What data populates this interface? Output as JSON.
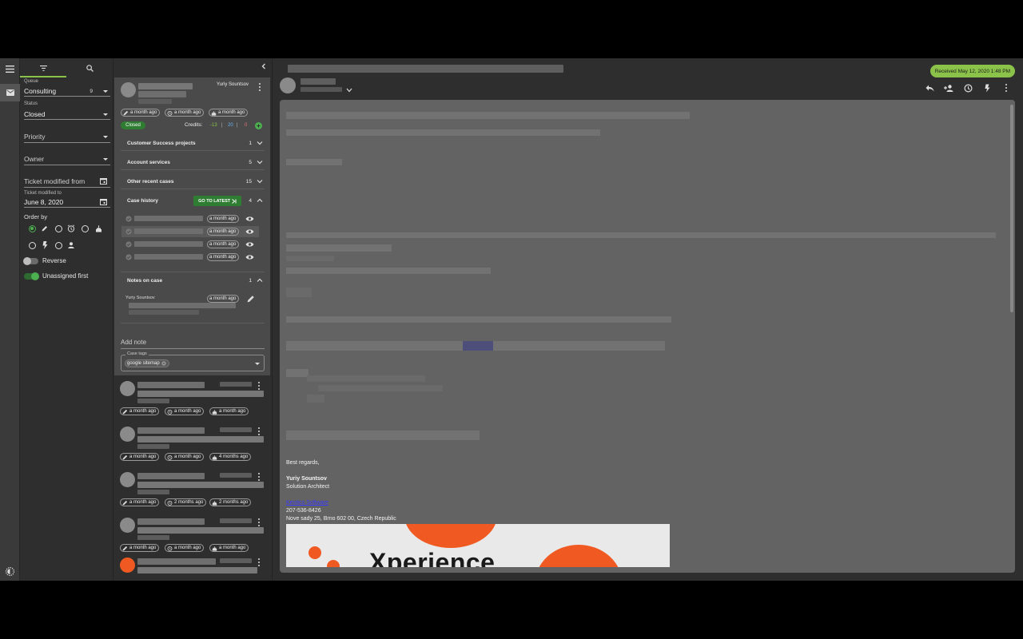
{
  "filters": {
    "queue_label": "Queue",
    "queue_value": "Consulting",
    "queue_count": "9",
    "status_label": "Status",
    "status_value": "Closed",
    "priority_placeholder": "Priority",
    "owner_placeholder": "Owner",
    "modified_from_placeholder": "Ticket modified from",
    "modified_to_label": "Ticket modified to",
    "modified_to_value": "June 8, 2020",
    "order_by_label": "Order by",
    "order_by_selected": "created",
    "reverse_label": "Reverse",
    "reverse_on": false,
    "unassigned_first_label": "Unassigned first",
    "unassigned_first_on": true
  },
  "case_card": {
    "owner_name": "Yuriy Sountsov",
    "chips": [
      "a month ago",
      "a month ago",
      "a month ago"
    ],
    "status_badge": "Closed",
    "credits_label": "Credits:",
    "credits_values": [
      "-13",
      "20",
      "0"
    ],
    "sections": [
      {
        "title": "Customer Success projects",
        "count": "1"
      },
      {
        "title": "Account services",
        "count": "5"
      },
      {
        "title": "Other recent cases",
        "count": "15"
      }
    ],
    "history": {
      "title": "Case history",
      "go_latest_label": "GO TO LATEST",
      "count": "4",
      "rows": [
        "a month ago",
        "a month ago",
        "a month ago",
        "a month ago"
      ]
    },
    "notes": {
      "title": "Notes on case",
      "count": "1",
      "author": "Yuriy Sountsov",
      "time": "a month ago"
    },
    "add_note_placeholder": "Add note",
    "case_tags_label": "Case tags",
    "tags": [
      "google sitemap"
    ]
  },
  "case_list": [
    {
      "chips": [
        "a month ago",
        "a month ago",
        "a month ago"
      ]
    },
    {
      "chips": [
        "a month ago",
        "a month ago",
        "4 months ago"
      ]
    },
    {
      "chips": [
        "a month ago",
        "2 months ago",
        "2 months ago"
      ]
    },
    {
      "chips": [
        "a month ago",
        "a month ago",
        "a month ago"
      ]
    }
  ],
  "mail": {
    "received_badge": "Received May 12, 2020 1:48 PM",
    "signature": {
      "greeting": "Best regards,",
      "name": "Yuriy Sountsov",
      "title": "Solution Architect",
      "link": "Kentico Software",
      "phone": "207-536-8426",
      "address": "Nove sady 25, Brno 602 00, Czech Republic"
    },
    "banner_text": "Xperience"
  },
  "colors": {
    "accent_green": "#8bc34a",
    "status_green": "#2e7d32",
    "brand_orange": "#f05a22",
    "credit_negative": "#8bc34a",
    "credit_positive": "#64b5f6",
    "credit_zero": "#e57373"
  },
  "icons": {
    "rail": [
      "menu-icon",
      "mail-icon",
      "brightness-icon"
    ],
    "filter_tabs": [
      "filter-icon",
      "search-icon"
    ],
    "order_by": [
      "radio",
      "pencil-icon",
      "radio",
      "alarm-icon",
      "radio",
      "cake-icon",
      "radio",
      "flash-icon",
      "radio",
      "person-icon"
    ],
    "toolbar": [
      "reply-icon",
      "person-add-icon",
      "history-icon",
      "flash-icon",
      "more-vert-icon"
    ]
  }
}
